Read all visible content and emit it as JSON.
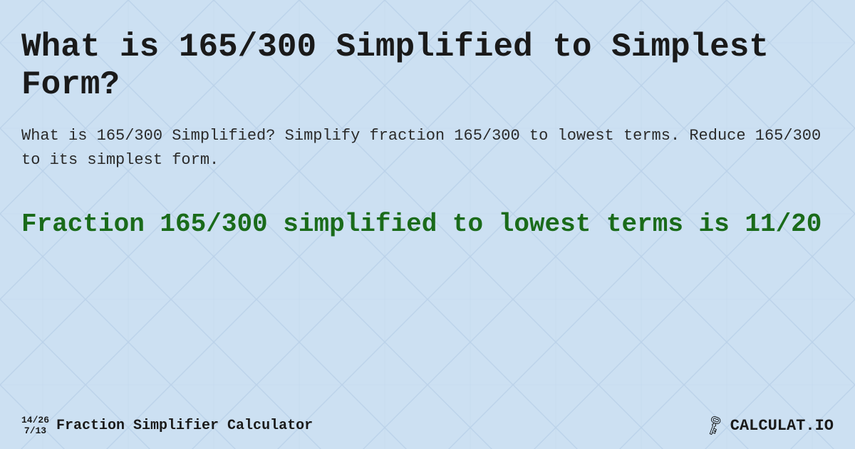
{
  "background": {
    "color": "#cde0f0",
    "pattern_color": "#b8cfe8"
  },
  "title": "What is 165/300 Simplified to Simplest Form?",
  "description": "What is 165/300 Simplified? Simplify fraction 165/300 to lowest terms. Reduce 165/300 to its simplest form.",
  "result": {
    "text": "Fraction 165/300 simplified to lowest terms is 11/20"
  },
  "footer": {
    "fraction_top": "14/26",
    "fraction_bottom": "7/13",
    "brand_name": "Fraction Simplifier Calculator",
    "logo_text": "CALCULAT.IO",
    "logo_prefix": "🔑"
  }
}
